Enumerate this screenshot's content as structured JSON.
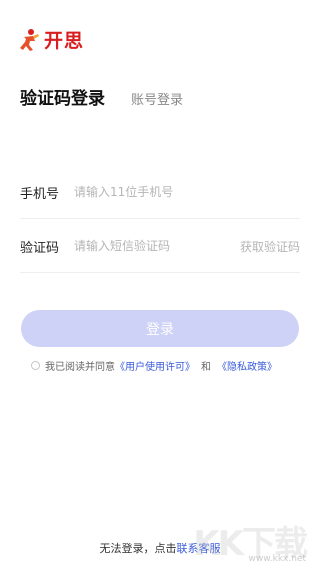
{
  "brand": {
    "name": "开思",
    "color": "#d81e1e"
  },
  "tabs": {
    "active": "验证码登录",
    "inactive": "账号登录"
  },
  "phone": {
    "label": "手机号",
    "placeholder": "请输入11位手机号",
    "value": ""
  },
  "code": {
    "label": "验证码",
    "placeholder": "请输入短信验证码",
    "value": "",
    "get_code": "获取验证码"
  },
  "login": {
    "label": "登录",
    "color": "#cdd2f6"
  },
  "agreement": {
    "prefix": "我已阅读并同意",
    "user_license": "《用户使用许可》",
    "and": "和",
    "privacy": "《隐私政策》",
    "checked": false,
    "link_color": "#3a5bd9"
  },
  "footer": {
    "text": "无法登录，点击",
    "link": "联系客服"
  },
  "watermark": {
    "text": "KK下载",
    "url": "www.kkx.net"
  }
}
